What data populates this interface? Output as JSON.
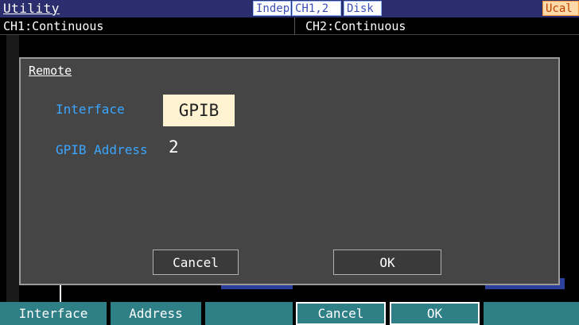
{
  "header": {
    "title": "Utility",
    "tags": {
      "indep": "Indep",
      "channels": "CH1,2",
      "disk": "Disk",
      "ucal": "Ucal"
    }
  },
  "channels": {
    "ch1": "CH1:Continuous",
    "ch2": "CH2:Continuous"
  },
  "dialog": {
    "title": "Remote",
    "interface_label": "Interface",
    "interface_value": "GPIB",
    "address_label": "GPIB Address",
    "address_value": "2",
    "cancel_label": "Cancel",
    "ok_label": "OK"
  },
  "softkeys": [
    "Interface",
    "Address",
    "",
    "Cancel",
    "OK",
    ""
  ],
  "colors": {
    "accent": "#3aa6ff",
    "softkey": "#2f7f86",
    "highlight": "#fff3d2"
  }
}
